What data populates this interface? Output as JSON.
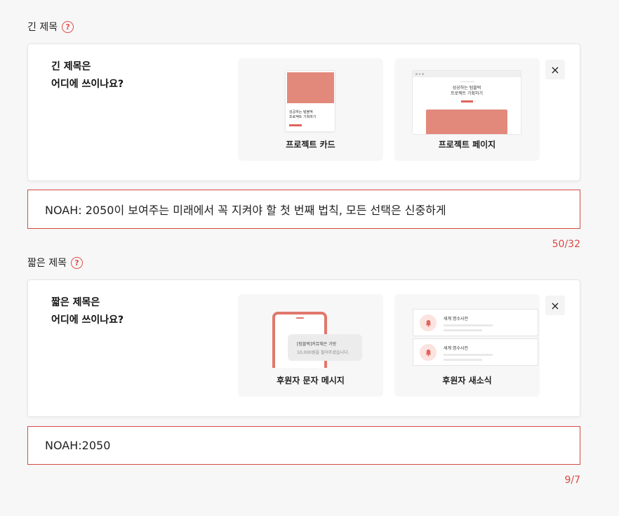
{
  "long_title": {
    "label": "긴 제목",
    "help_icon": "?",
    "card": {
      "question_line1": "긴 제목은",
      "question_line2": "어디에 쓰이나요?",
      "close_label": "×",
      "examples": [
        {
          "caption": "프로젝트 카드",
          "mock_text_line1": "성공하는 텀블벅",
          "mock_text_line2": "프로젝트 기획하기"
        },
        {
          "caption": "프로젝트 페이지",
          "mock_text_line1": "성공하는 텀블벅",
          "mock_text_line2": "프로젝트 기획하기"
        }
      ]
    },
    "input_value": "NOAH: 2050이 보여주는 미래에서 꼭 지켜야 할 첫 번째 법칙, 모든 선택은 신중하게",
    "counter": "50/32"
  },
  "short_title": {
    "label": "짧은 제목",
    "help_icon": "?",
    "card": {
      "question_line1": "짧은 제목은",
      "question_line2": "어디에 쓰이나요?",
      "close_label": "×",
      "examples": [
        {
          "caption": "후원자 문자 메시지",
          "mock_text_line1": "[텀블벅]커뮤채은 가방",
          "mock_text_line2": "10,000원을 필어주셨습니다."
        },
        {
          "caption": "후원자 새소식",
          "mock_notice_1": "세계 명수사전",
          "mock_notice_2": "세계 명수사전"
        }
      ]
    },
    "input_value": "NOAH:2050",
    "counter": "9/7"
  },
  "colors": {
    "accent": "#d64a45",
    "mock_fill": "#e2897b"
  }
}
